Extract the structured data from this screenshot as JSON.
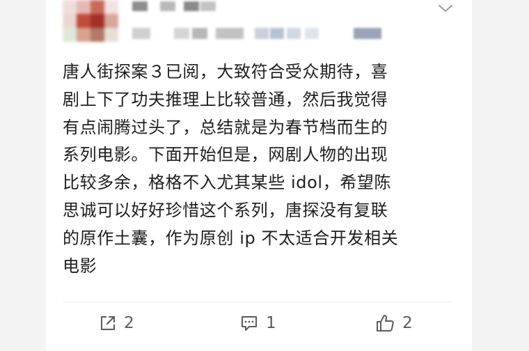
{
  "post": {
    "lines": [
      "唐人街探案３已阅，大致符合受众期待，喜",
      "剧上下了功夫推理上比较普通，然后我觉得",
      "有点闹腾过头了，总结就是为春节档而生的",
      "系列电影。下面开始但是，网剧人物的出现",
      "比较多余，格格不入尤其某些 idol，希望陈",
      "思诚可以好好珍惜这个系列，唐探没有复联",
      "的原作土囊，作为原创 ip 不太适合开发相关",
      "电影"
    ]
  },
  "actions": {
    "share_count": "2",
    "comment_count": "1",
    "like_count": "2"
  },
  "icons": {
    "more": "chevron-down-icon",
    "share": "share-icon",
    "comment": "comment-icon",
    "like": "thumbs-up-icon"
  },
  "colors": {
    "text": "#1e1e1e",
    "muted": "#5a5a5a",
    "background": "#f3f3f3",
    "card": "#ffffff"
  }
}
